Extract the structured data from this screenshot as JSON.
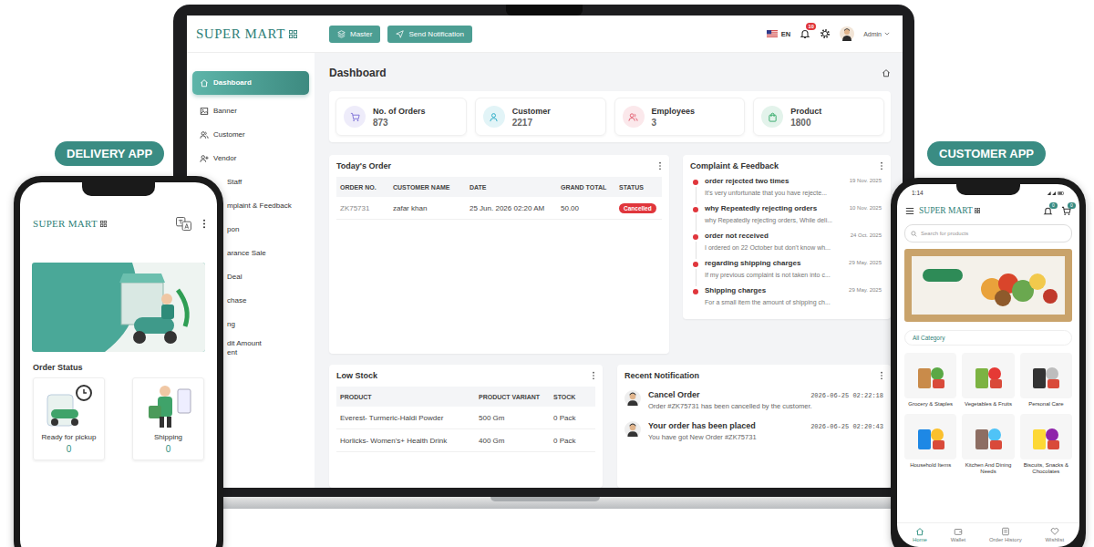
{
  "labels": {
    "delivery": "DELIVERY APP",
    "customer": "CUSTOMER APP"
  },
  "admin": {
    "logo": "SUPER MART",
    "top_buttons": [
      "Master",
      "Send Notification"
    ],
    "language": "EN",
    "notification_badge": "10",
    "user": "Admin",
    "sidebar": [
      {
        "label": "Dashboard",
        "selected": true,
        "kind": "full"
      },
      {
        "label": "Banner",
        "selected": false,
        "kind": "full"
      },
      {
        "label": "Customer",
        "selected": false,
        "kind": "full"
      },
      {
        "label": "Vendor",
        "selected": false,
        "kind": "full"
      },
      {
        "label": "Staff",
        "selected": false,
        "kind": "cut"
      },
      {
        "label": "mplaint & Feedback",
        "selected": false,
        "kind": "cut"
      },
      {
        "label": "pon",
        "selected": false,
        "kind": "cut"
      },
      {
        "label": "arance Sale",
        "selected": false,
        "kind": "cut"
      },
      {
        "label": "Deal",
        "selected": false,
        "kind": "cut"
      },
      {
        "label": "chase",
        "selected": false,
        "kind": "cut"
      },
      {
        "label": "ng",
        "selected": false,
        "kind": "cut"
      },
      {
        "label": "dit Amount\nent",
        "selected": false,
        "kind": "cut"
      }
    ],
    "page_title": "Dashboard",
    "stats": [
      {
        "label": "No. of Orders",
        "value": "873",
        "color": "#7c6fd6"
      },
      {
        "label": "Customer",
        "value": "2217",
        "color": "#22a9c4"
      },
      {
        "label": "Employees",
        "value": "3",
        "color": "#e0566a"
      },
      {
        "label": "Product",
        "value": "1800",
        "color": "#2fa866"
      }
    ],
    "todays_order": {
      "title": "Today's Order",
      "columns": [
        "ORDER NO.",
        "CUSTOMER NAME",
        "DATE",
        "GRAND TOTAL",
        "STATUS"
      ],
      "rows": [
        {
          "cells": [
            "ZK75731",
            "zafar khan",
            "25 Jun. 2026 02:20 AM",
            "50.00"
          ],
          "status": "Cancelled"
        }
      ]
    },
    "complaints": {
      "title": "Complaint & Feedback",
      "items": [
        {
          "title": "order rejected two times",
          "date": "19 Nov. 2025",
          "text": "It's very unfortunate that you have rejecte..."
        },
        {
          "title": "why Repeatedly rejecting orders",
          "date": "10 Nov. 2025",
          "text": "why Repeatedly rejecting orders, While deli..."
        },
        {
          "title": "order not received",
          "date": "24 Oct. 2025",
          "text": "I ordered on 22 October but don't know wh..."
        },
        {
          "title": "regarding shipping charges",
          "date": "29 May. 2025",
          "text": "If my previous complaint is not taken into c..."
        },
        {
          "title": "Shipping charges",
          "date": "29 May. 2025",
          "text": "For a small item the amount of shipping ch..."
        }
      ]
    },
    "low_stock": {
      "title": "Low Stock",
      "columns": [
        "PRODUCT",
        "PRODUCT VARIANT",
        "STOCK"
      ],
      "rows": [
        [
          "Everest- Turmeric-Haldi Powder",
          "500 Gm",
          "0 Pack"
        ],
        [
          "Horlicks- Women's+ Health Drink",
          "400 Gm",
          "0 Pack"
        ]
      ]
    },
    "notifications": {
      "title": "Recent Notification",
      "items": [
        {
          "title": "Cancel Order",
          "time": "2026-06-25 02:22:18",
          "text": "Order #ZK75731 has been cancelled by the customer."
        },
        {
          "title": "Your order has been placed",
          "time": "2026-06-25 02:20:43",
          "text": "You have got New Order #ZK75731"
        }
      ]
    }
  },
  "delivery_app": {
    "logo": "SUPER MART",
    "section": "Order Status",
    "cards": [
      {
        "label": "Ready for pickup",
        "count": "0"
      },
      {
        "label": "Shipping",
        "count": "0"
      }
    ]
  },
  "customer_app": {
    "time": "1:14",
    "logo": "SUPER MART",
    "notification_badge": "0",
    "cart_badge": "0",
    "search": {
      "placeholder": "Search for products"
    },
    "all_category": "All Category",
    "categories": [
      "Grocery & Staples",
      "Vegetables & Fruits",
      "Personal Care",
      "Household Items",
      "Kitchen And Dining Needs",
      "Biscuits, Snacks & Chocolates"
    ],
    "nav": [
      {
        "label": "Home",
        "selected": true
      },
      {
        "label": "Wallet",
        "selected": false
      },
      {
        "label": "Order History",
        "selected": false
      },
      {
        "label": "Wishlist",
        "selected": false
      }
    ]
  }
}
